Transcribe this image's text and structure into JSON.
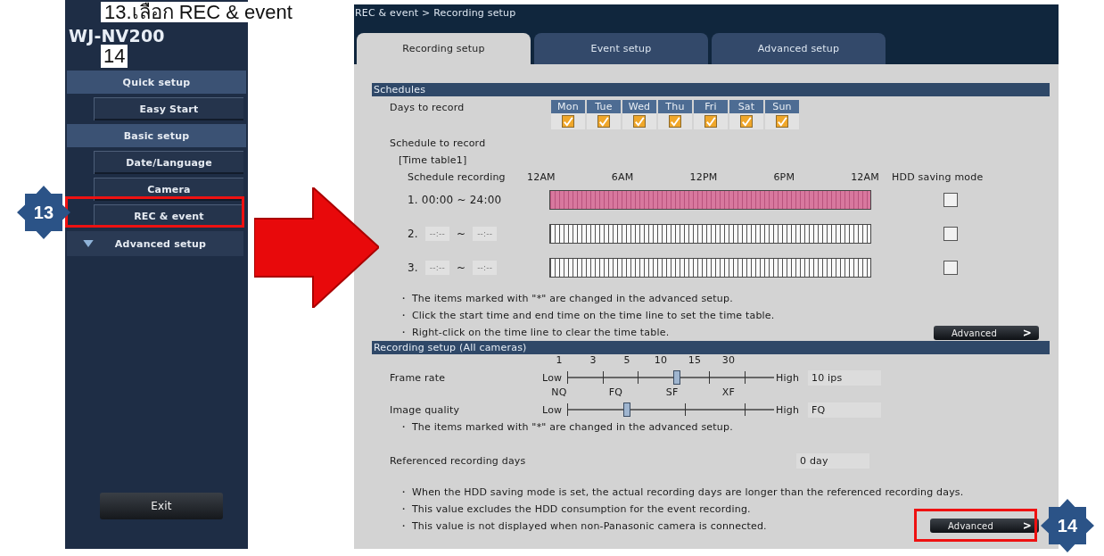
{
  "annotations": {
    "caption": "13.เลือก REC & event",
    "step_label": "14",
    "badges": [
      "13",
      "14"
    ]
  },
  "sidebar": {
    "model": "WJ-NV200",
    "items": [
      {
        "label": "Quick setup",
        "kind": "header"
      },
      {
        "label": "Easy Start",
        "kind": "button"
      },
      {
        "label": "Basic setup",
        "kind": "header"
      },
      {
        "label": "Date/Language",
        "kind": "button"
      },
      {
        "label": "Camera",
        "kind": "button"
      },
      {
        "label": "REC & event",
        "kind": "button"
      },
      {
        "label": "Advanced setup",
        "kind": "toggle"
      }
    ],
    "exit": "Exit"
  },
  "main": {
    "breadcrumb": "REC & event > Recording setup",
    "tabs": [
      {
        "label": "Recording setup",
        "selected": true
      },
      {
        "label": "Event setup",
        "selected": false
      },
      {
        "label": "Advanced setup",
        "selected": false
      }
    ],
    "schedules": {
      "title": "Schedules",
      "days_label": "Days to record",
      "days": [
        {
          "label": "Mon",
          "checked": true
        },
        {
          "label": "Tue",
          "checked": true
        },
        {
          "label": "Wed",
          "checked": true
        },
        {
          "label": "Thu",
          "checked": true
        },
        {
          "label": "Fri",
          "checked": true
        },
        {
          "label": "Sat",
          "checked": true
        },
        {
          "label": "Sun",
          "checked": true
        }
      ],
      "schedule_label": "Schedule to record",
      "timetable": "[Time table1]",
      "recording_label": "Schedule recording",
      "time_marks": [
        "12AM",
        "6AM",
        "12PM",
        "6PM",
        "12AM"
      ],
      "hdd_label": "HDD saving mode",
      "rows": [
        {
          "number": "1.",
          "start": "00:00",
          "separator": "~",
          "end": "24:00",
          "kind": "text",
          "recorded": true,
          "hdd_saving": false
        },
        {
          "number": "2.",
          "start": "--:--",
          "separator": "~",
          "end": "--:--",
          "kind": "field",
          "recorded": false,
          "hdd_saving": false
        },
        {
          "number": "3.",
          "start": "--:--",
          "separator": "~",
          "end": "--:--",
          "kind": "field",
          "recorded": false,
          "hdd_saving": false
        }
      ],
      "notes": [
        "・ The items marked with \"*\" are changed in the advanced setup.",
        "・ Click the start time and end time on the time line to set the time table.",
        "・ Right-click on the time line to clear the time table."
      ],
      "advanced_button": "Advanced",
      "button_arrow": ">"
    },
    "recording": {
      "title": "Recording setup (All cameras)",
      "sliders": [
        {
          "label": "Frame rate",
          "ticks": [
            "1",
            "3",
            "5",
            "10",
            "15",
            "30"
          ],
          "low": "Low",
          "high": "High",
          "level": 0.53,
          "value": "10 ips"
        },
        {
          "label": "Image quality",
          "ticks": [
            "NQ",
            "FQ",
            "SF",
            "XF"
          ],
          "low": "Low",
          "high": "High",
          "level": 0.29,
          "value": "FQ"
        }
      ],
      "note": "・ The items marked with \"*\" are changed in the advanced setup.",
      "days_label": "Referenced recording days",
      "days_value": "0 day",
      "notes": [
        "・ When the HDD saving mode is set, the actual recording days are longer than the referenced recording days.",
        "・ This value excludes the HDD consumption for the event recording.",
        "・ This value is not displayed when non-Panasonic camera is connected."
      ],
      "advanced_button": "Advanced",
      "button_arrow": ">"
    }
  }
}
